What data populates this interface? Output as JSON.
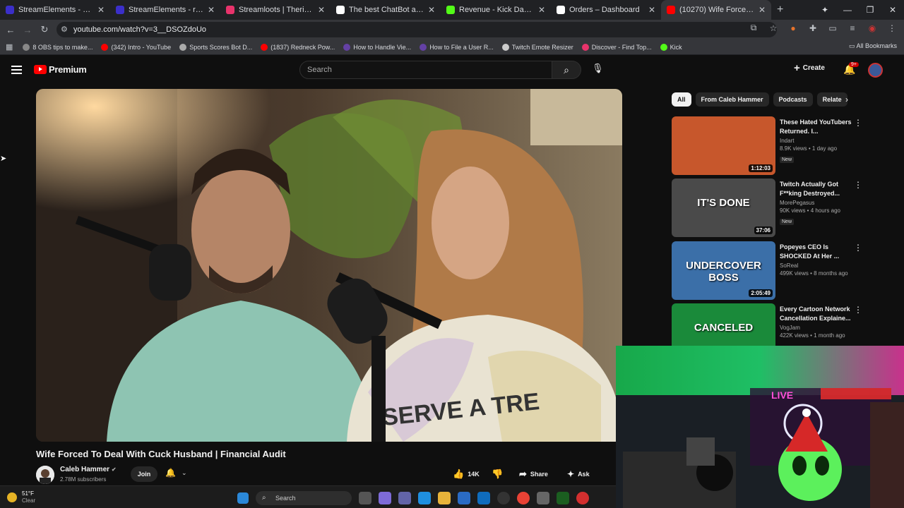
{
  "browser": {
    "tabs": [
      {
        "title": "StreamElements - Overlays",
        "color": "#3b2fc9"
      },
      {
        "title": "StreamElements - rippedredne",
        "color": "#3b2fc9"
      },
      {
        "title": "Streamloots | Theripped redne",
        "color": "#e8336b"
      },
      {
        "title": "The best ChatBot and Widgets",
        "color": "#ffffff"
      },
      {
        "title": "Revenue - Kick Dashboard",
        "color": "#53fc18"
      },
      {
        "title": "Orders – Dashboard",
        "color": "#ffffff"
      },
      {
        "title": "(10270) Wife Forced To De",
        "color": "#ff0000",
        "active": true
      }
    ],
    "url": "youtube.com/watch?v=3__DSOZdoUo",
    "bookmarks": [
      {
        "label": "8 OBS tips to make...",
        "color": "#888"
      },
      {
        "label": "(342) Intro - YouTube",
        "color": "#ff0000"
      },
      {
        "label": "Sports Scores Bot D...",
        "color": "#aaa"
      },
      {
        "label": "(1837) Redneck Pow...",
        "color": "#ff0000"
      },
      {
        "label": "How to Handle Vie...",
        "color": "#6441a5"
      },
      {
        "label": "How to File a User R...",
        "color": "#6441a5"
      },
      {
        "label": "Twitch Emote Resizer",
        "color": "#ccc"
      },
      {
        "label": "Discover - Find Top...",
        "color": "#e8336b"
      },
      {
        "label": "Kick",
        "color": "#53fc18"
      }
    ],
    "all_bookmarks": "All Bookmarks"
  },
  "youtube": {
    "brand": "Premium",
    "search_placeholder": "Search",
    "create_label": "Create",
    "notif_count": "9+",
    "chips": [
      "All",
      "From Caleb Hammer",
      "Podcasts",
      "Relate"
    ],
    "recommendations": [
      {
        "title": "These Hated YouTubers Returned. I...",
        "channel": "Indart",
        "meta": "8.9K views • 1 day ago",
        "badge": "New",
        "duration": "1:12:03"
      },
      {
        "title": "Twitch Actually Got F**king Destroyed...",
        "channel": "MorePegasus",
        "meta": "90K views • 4 hours ago",
        "badge": "New",
        "duration": "37:06",
        "thumb_text": "IT'S DONE"
      },
      {
        "title": "Popeyes CEO Is SHOCKED At Her ...",
        "channel": "SoReal",
        "meta": "499K views • 8 months ago",
        "duration": "2:05:49",
        "thumb_text": "UNDERCOVER BOSS"
      },
      {
        "title": "Every Cartoon Network Cancellation Explaine...",
        "channel": "VogJam",
        "meta": "422K views • 1 month ago",
        "thumb_text": "CANCELED"
      }
    ],
    "video": {
      "title": "Wife Forced To Deal With Cuck Husband | Financial Audit",
      "channel": "Caleb Hammer",
      "subscribers": "2.78M subscribers",
      "join_label": "Join",
      "likes": "14K",
      "share_label": "Share",
      "ask_label": "Ask",
      "shirt_text": "SERVE A TRE"
    }
  },
  "taskbar": {
    "temp": "51°F",
    "condition": "Clear",
    "search_label": "Search"
  }
}
